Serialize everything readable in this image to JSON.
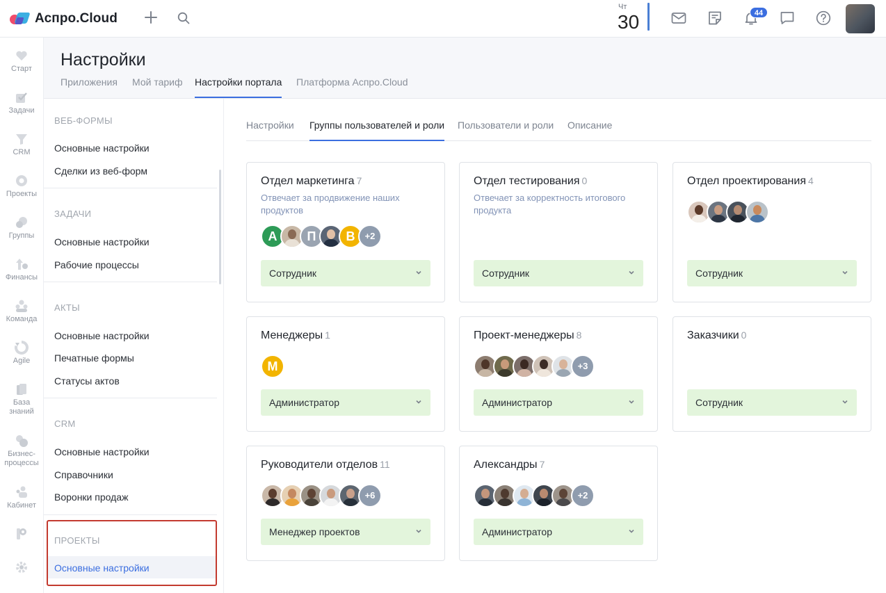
{
  "app": {
    "name": "Аспро.Cloud"
  },
  "topbar": {
    "day_name": "Чт",
    "day_number": "30",
    "notifications_badge": "44"
  },
  "rail": {
    "items": [
      {
        "label": "Старт",
        "icon": "heart-icon"
      },
      {
        "label": "Задачи",
        "icon": "tasks-icon"
      },
      {
        "label": "CRM",
        "icon": "crm-icon"
      },
      {
        "label": "Проекты",
        "icon": "projects-icon"
      },
      {
        "label": "Группы",
        "icon": "groups-icon"
      },
      {
        "label": "Финансы",
        "icon": "finance-icon"
      },
      {
        "label": "Команда",
        "icon": "team-icon"
      },
      {
        "label": "Agile",
        "icon": "agile-icon"
      },
      {
        "label": "База\nзнаний",
        "icon": "knowledge-icon"
      },
      {
        "label": "Бизнес-\nпроцессы",
        "icon": "business-process-icon"
      },
      {
        "label": "Кабинет",
        "icon": "cabinet-icon"
      }
    ]
  },
  "header": {
    "title": "Настройки",
    "tabs": [
      "Приложения",
      "Мой тариф",
      "Настройки портала",
      "Платформа Аспро.Cloud"
    ],
    "active_tab": "Настройки портала"
  },
  "sidebar": {
    "sections": [
      {
        "title": "ВЕБ-ФОРМЫ",
        "items": [
          "Основные настройки",
          "Сделки из веб-форм"
        ]
      },
      {
        "title": "ЗАДАЧИ",
        "items": [
          "Основные настройки",
          "Рабочие процессы"
        ]
      },
      {
        "title": "АКТЫ",
        "items": [
          "Основные настройки",
          "Печатные формы",
          "Статусы актов"
        ]
      },
      {
        "title": "CRM",
        "items": [
          "Основные настройки",
          "Справочники",
          "Воронки продаж"
        ]
      },
      {
        "title": "ПРОЕКТЫ",
        "items": [
          "Основные настройки"
        ]
      }
    ]
  },
  "subtabs": {
    "items": [
      "Настройки",
      "Группы пользователей и роли",
      "Пользователи и роли",
      "Описание"
    ],
    "active": "Группы пользователей и роли"
  },
  "groups": [
    {
      "name": "Отдел маркетинга",
      "count": "7",
      "description": "Отвечает за продвижение наших продуктов",
      "more": "+2",
      "letters": [
        "А",
        "",
        "П",
        "",
        "В"
      ],
      "role": "Сотрудник"
    },
    {
      "name": "Отдел тестирования",
      "count": "0",
      "description": "Отвечает за корректность итогового продукта",
      "role": "Сотрудник"
    },
    {
      "name": "Отдел проектирования",
      "count": "4",
      "description": "",
      "role": "Сотрудник"
    },
    {
      "name": "Менеджеры",
      "count": "1",
      "description": "",
      "letters": [
        "М"
      ],
      "role": "Администратор"
    },
    {
      "name": "Проект-менеджеры",
      "count": "8",
      "description": "",
      "more": "+3",
      "role": "Администратор"
    },
    {
      "name": "Заказчики",
      "count": "0",
      "description": "",
      "role": "Сотрудник"
    },
    {
      "name": "Руководители отделов",
      "count": "11",
      "description": "",
      "more": "+6",
      "role": "Менеджер проектов"
    },
    {
      "name": "Александры",
      "count": "7",
      "description": "",
      "more": "+2",
      "role": "Администратор"
    }
  ],
  "colors": {
    "accent": "#3b6ee0",
    "role_bg": "#e3f5dc",
    "highlight": "#c33a2f"
  }
}
